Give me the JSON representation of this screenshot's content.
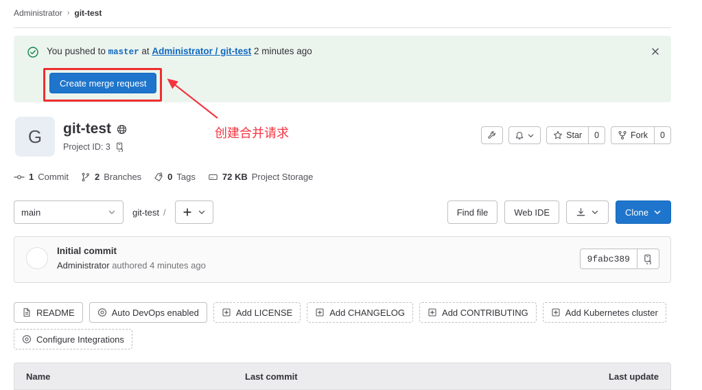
{
  "breadcrumb": {
    "root": "Administrator",
    "separator": "›",
    "current": "git-test"
  },
  "banner": {
    "prefix": "You pushed to",
    "branch": "master",
    "at": "at",
    "project_link": "Administrator / git-test",
    "time": "2 minutes ago",
    "merge_request_button": "Create merge request",
    "check_icon": "check-circle-icon",
    "close_icon": "close-icon",
    "background_color": "#ecf4ee",
    "link_color": "#1068bf",
    "check_color": "#108548"
  },
  "annotation": {
    "text": "创建合并请求",
    "color": "#f5333f",
    "highlight_color": "#ee2d2d"
  },
  "project": {
    "avatar_letter": "G",
    "name": "git-test",
    "visibility_icon": "globe-icon",
    "id_label": "Project ID: 3",
    "copy_icon": "copy-icon",
    "actions": {
      "settings_icon": "wrench-icon",
      "notifications_icon": "bell-icon",
      "notifications_chevron": "chevron-down-icon",
      "star_label": "Star",
      "star_count": "0",
      "star_icon": "star-icon",
      "fork_label": "Fork",
      "fork_count": "0",
      "fork_icon": "fork-icon"
    }
  },
  "stats": [
    {
      "icon": "commit-icon",
      "value": "1",
      "label": "Commit"
    },
    {
      "icon": "branch-icon",
      "value": "2",
      "label": "Branches"
    },
    {
      "icon": "tag-icon",
      "value": "0",
      "label": "Tags"
    },
    {
      "icon": "storage-icon",
      "value": "72 KB",
      "label": "Project Storage"
    }
  ],
  "repo_bar": {
    "branch_selected": "main",
    "branch_chevron": "chevron-down-icon",
    "path_root": "git-test",
    "path_slash": "/",
    "add_icon": "plus-icon",
    "add_chevron": "chevron-down-icon",
    "find_file": "Find file",
    "web_ide": "Web IDE",
    "download_icon": "download-icon",
    "download_chevron": "chevron-down-icon",
    "clone_label": "Clone",
    "clone_chevron": "chevron-down-icon",
    "clone_color": "#1f75cb"
  },
  "last_commit": {
    "title": "Initial commit",
    "author": "Administrator",
    "meta": "authored 4 minutes ago",
    "sha": "9fabc389",
    "copy_icon": "copy-icon",
    "avatar_icon": "user-avatar"
  },
  "chips": [
    {
      "label": "README",
      "icon": "file-icon",
      "dashed": false
    },
    {
      "label": "Auto DevOps enabled",
      "icon": "gear-icon",
      "dashed": false
    },
    {
      "label": "Add LICENSE",
      "icon": "plus-square-icon",
      "dashed": true
    },
    {
      "label": "Add CHANGELOG",
      "icon": "plus-square-icon",
      "dashed": true
    },
    {
      "label": "Add CONTRIBUTING",
      "icon": "plus-square-icon",
      "dashed": true
    },
    {
      "label": "Add Kubernetes cluster",
      "icon": "plus-square-icon",
      "dashed": true
    },
    {
      "label": "Configure Integrations",
      "icon": "gear-icon",
      "dashed": true
    }
  ],
  "file_table": {
    "columns": [
      "Name",
      "Last commit",
      "Last update"
    ]
  }
}
